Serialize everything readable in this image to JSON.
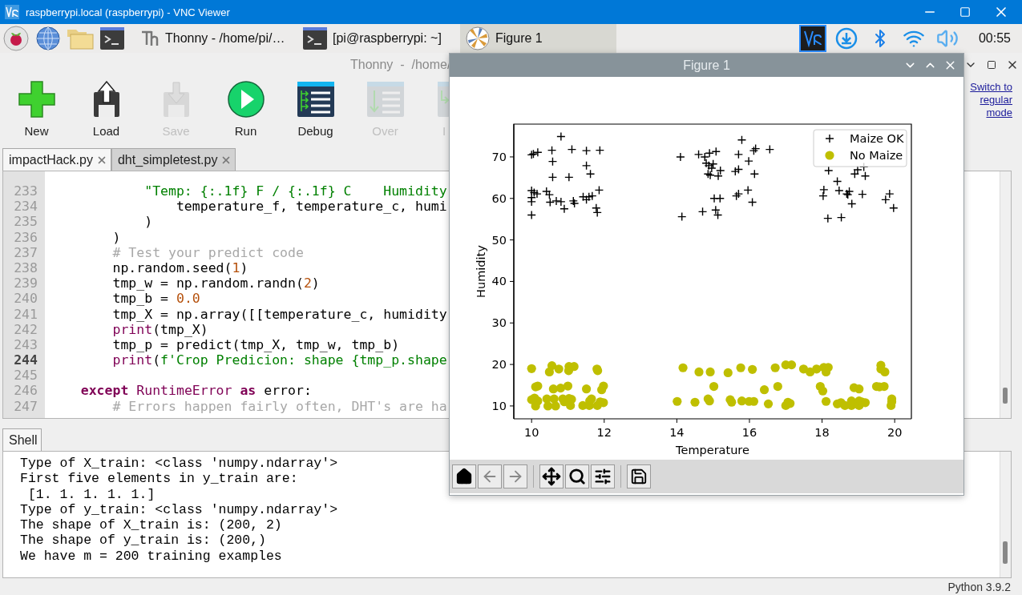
{
  "vnc_window": {
    "title": "raspberrypi.local (raspberrypi) - VNC Viewer"
  },
  "taskbar": {
    "launchers": [
      {
        "kind": "raspberry"
      },
      {
        "kind": "globe"
      },
      {
        "kind": "folder"
      },
      {
        "kind": "terminal"
      }
    ],
    "tasks": [
      {
        "kind": "thonny",
        "label": "Thonny  -  /home/pi/…",
        "selected": false
      },
      {
        "kind": "terminal",
        "label": "[pi@raspberrypi: ~]",
        "selected": false
      },
      {
        "kind": "figure",
        "label": "Figure 1",
        "selected": true
      }
    ],
    "tray": [
      {
        "kind": "vnc",
        "selected": true
      },
      {
        "kind": "download",
        "selected": false
      },
      {
        "kind": "bluetooth",
        "selected": false
      },
      {
        "kind": "wifi",
        "selected": false
      },
      {
        "kind": "volume",
        "selected": false
      }
    ],
    "clock": "00:55"
  },
  "thonny": {
    "title": "Thonny  -  /home/",
    "toolbar": [
      {
        "kind": "new",
        "label": "New",
        "disabled": false
      },
      {
        "kind": "load",
        "label": "Load",
        "disabled": false
      },
      {
        "kind": "save",
        "label": "Save",
        "disabled": true
      },
      {
        "kind": "run",
        "label": "Run",
        "disabled": false
      },
      {
        "kind": "debug",
        "label": "Debug",
        "disabled": false
      },
      {
        "kind": "over",
        "label": "Over",
        "disabled": true
      },
      {
        "kind": "into",
        "label": "I",
        "disabled": true
      }
    ],
    "mode_link": "Switch to regular mode",
    "tabs": [
      {
        "label": "impactHack.py",
        "selected": true
      },
      {
        "label": "dht_simpletest.py",
        "selected": false
      }
    ],
    "editor": {
      "lines": [
        {
          "number": "233",
          "current": false,
          "tokens": [
            {
              "text": "            \"Temp: {:.1f} F / {:.1f} C    Humidity",
              "kind": "string"
            }
          ]
        },
        {
          "number": "234",
          "current": false,
          "tokens": [
            {
              "text": "                temperature_f, temperature_c, humi",
              "kind": "plain"
            }
          ]
        },
        {
          "number": "235",
          "current": false,
          "tokens": [
            {
              "text": "            )",
              "kind": "plain"
            }
          ]
        },
        {
          "number": "236",
          "current": false,
          "tokens": [
            {
              "text": "        )",
              "kind": "plain"
            }
          ]
        },
        {
          "number": "237",
          "current": false,
          "tokens": [
            {
              "text": "        # Test your predict code",
              "kind": "comment"
            }
          ]
        },
        {
          "number": "238",
          "current": false,
          "tokens": [
            {
              "text": "        np.random.seed(",
              "kind": "plain"
            },
            {
              "text": "1",
              "kind": "number"
            },
            {
              "text": ")",
              "kind": "plain"
            }
          ]
        },
        {
          "number": "239",
          "current": false,
          "tokens": [
            {
              "text": "        tmp_w = np.random.randn(",
              "kind": "plain"
            },
            {
              "text": "2",
              "kind": "number"
            },
            {
              "text": ")",
              "kind": "plain"
            }
          ]
        },
        {
          "number": "240",
          "current": false,
          "tokens": [
            {
              "text": "        tmp_b = ",
              "kind": "plain"
            },
            {
              "text": "0.0",
              "kind": "number"
            }
          ]
        },
        {
          "number": "241",
          "current": false,
          "tokens": [
            {
              "text": "        tmp_X = np.array([[temperature_c, humidity",
              "kind": "plain"
            }
          ]
        },
        {
          "number": "242",
          "current": false,
          "tokens": [
            {
              "text": "        print",
              "kind": "builtin"
            },
            {
              "text": "(tmp_X)",
              "kind": "plain"
            }
          ]
        },
        {
          "number": "243",
          "current": false,
          "tokens": [
            {
              "text": "        tmp_p = predict(tmp_X, tmp_w, tmp_b)",
              "kind": "plain"
            }
          ]
        },
        {
          "number": "244",
          "current": true,
          "tokens": [
            {
              "text": "        print",
              "kind": "builtin"
            },
            {
              "text": "(",
              "kind": "plain"
            },
            {
              "text": "f'Crop Predicion: shape {tmp_p.shape",
              "kind": "string"
            }
          ]
        },
        {
          "number": "245",
          "current": false
        },
        {
          "number": "246",
          "current": false,
          "tokens": [
            {
              "text": "    except",
              "kind": "keyword"
            },
            {
              "text": " RuntimeError",
              "kind": "builtin"
            },
            {
              "text": " as",
              "kind": "keyword"
            },
            {
              "text": " error:",
              "kind": "plain"
            }
          ]
        },
        {
          "number": "247",
          "current": false,
          "tokens": [
            {
              "text": "        # Errors happen fairly often, DHT's are ha",
              "kind": "comment"
            }
          ]
        }
      ]
    },
    "shell": {
      "tab": "Shell",
      "lines": [
        "Type of X_train: <class 'numpy.ndarray'>",
        "First five elements in y_train are:",
        " [1. 1. 1. 1. 1.]",
        "Type of y_train: <class 'numpy.ndarray'>",
        "The shape of X_train is: (200, 2)",
        "The shape of y_train is: (200,)",
        "We have m = 200 training examples"
      ]
    },
    "status": "Python 3.9.2"
  },
  "figure": {
    "title": "Figure 1",
    "chart_data": {
      "type": "scatter",
      "legend": "upper right",
      "xlabel": "Temperature",
      "ylabel": "Humidity",
      "xlim": [
        9.51,
        20.46
      ],
      "ylim": [
        6.9,
        77.9
      ],
      "xticks": [
        10,
        12,
        14,
        16,
        18,
        20
      ],
      "yticks": [
        10,
        20,
        30,
        40,
        50,
        60,
        70
      ],
      "series": [
        {
          "name": "Maize OK",
          "color": "#000000",
          "marker": "plus",
          "x": [
            10.0,
            10.05,
            10.17,
            10.56,
            10.81,
            11.11,
            11.51,
            11.88,
            10.58,
            11.51,
            11.62,
            10.58,
            11.03,
            10.0,
            10.07,
            10.15,
            10.0,
            10.0,
            10.41,
            10.49,
            10.51,
            10.68,
            10.81,
            10.9,
            11.15,
            11.18,
            11.42,
            11.51,
            11.58,
            11.67,
            11.86,
            11.78,
            11.81,
            10.0,
            14.1,
            14.6,
            14.77,
            14.9,
            15.08,
            15.79,
            15.7,
            16.12,
            16.17,
            16.56,
            15.98,
            14.81,
            14.88,
            15.0,
            14.96,
            14.86,
            14.92,
            15.14,
            15.2,
            15.61,
            15.7,
            16.14,
            15.96,
            15.03,
            15.19,
            15.64,
            15.7,
            16.08,
            15.07,
            15.13,
            14.71,
            14.14,
            18.18,
            18.42,
            18.05,
            18.03,
            18.47,
            18.68,
            18.75,
            18.71,
            18.82,
            18.9,
            19.11,
            19.19,
            18.98,
            19.15,
            18.16,
            18.53,
            19.75,
            19.86,
            19.97
          ],
          "values": [
            70.5,
            70.7,
            71.1,
            71.6,
            74.9,
            71.8,
            71.5,
            71.6,
            68.9,
            67.9,
            65.9,
            65.1,
            65.1,
            61.9,
            61.4,
            61.1,
            60.2,
            59.2,
            61.7,
            60.9,
            59.1,
            59.4,
            59.2,
            57.5,
            59.4,
            58.8,
            60.4,
            59.7,
            60.4,
            60.6,
            62.0,
            57.7,
            56.6,
            56.0,
            70.0,
            70.6,
            70.0,
            70.9,
            71.3,
            74.1,
            70.6,
            71.5,
            72.0,
            71.8,
            69.0,
            68.5,
            67.9,
            68.3,
            67.3,
            65.9,
            65.6,
            65.4,
            66.7,
            66.5,
            67.0,
            65.9,
            62.0,
            60.0,
            60.0,
            60.6,
            61.1,
            59.1,
            57.2,
            56.0,
            56.8,
            55.6,
            66.7,
            64.1,
            62.1,
            60.6,
            61.9,
            61.1,
            61.7,
            60.9,
            58.7,
            65.9,
            61.0,
            65.4,
            66.9,
            67.6,
            55.2,
            55.4,
            59.7,
            61.1,
            57.7
          ]
        },
        {
          "name": "No Maize",
          "color": "#bfbf00",
          "marker": "circle",
          "x": [
            10.0,
            10.56,
            10.49,
            10.75,
            11.03,
            11.02,
            11.17,
            11.8,
            11.82,
            10.11,
            10.17,
            10.6,
            10.8,
            11.0,
            11.51,
            11.98,
            11.93,
            10.0,
            10.08,
            10.17,
            10.11,
            10.42,
            10.62,
            10.45,
            10.66,
            10.86,
            10.9,
            11.03,
            11.1,
            11.07,
            11.41,
            11.59,
            11.65,
            11.6,
            11.81,
            11.89,
            11.98,
            14.17,
            14.61,
            14.92,
            15.41,
            15.76,
            16.08,
            15.02,
            16.41,
            16.78,
            16.71,
            17.0,
            17.16,
            17.49,
            17.67,
            17.85,
            18.05,
            18.17,
            18.11,
            17.95,
            18.02,
            14.01,
            14.5,
            14.86,
            14.9,
            15.47,
            15.51,
            15.79,
            15.99,
            16.12,
            16.52,
            17.0,
            17.06,
            17.12,
            18.11,
            18.42,
            18.52,
            18.63,
            18.81,
            18.81,
            18.88,
            19.02,
            19.02,
            19.02,
            19.09,
            19.19,
            19.5,
            19.58,
            19.71,
            19.62,
            19.62,
            19.73,
            19.92,
            19.92,
            19.9
          ],
          "values": [
            19.0,
            19.7,
            18.2,
            18.9,
            19.5,
            18.5,
            19.5,
            18.9,
            18.5,
            14.6,
            14.8,
            14.1,
            14.3,
            14.8,
            14.1,
            14.8,
            13.9,
            11.5,
            11.9,
            11.2,
            10.0,
            11.7,
            11.7,
            10.0,
            10.0,
            11.7,
            11.0,
            11.8,
            11.6,
            10.1,
            10.1,
            10.1,
            11.7,
            11.2,
            10.1,
            11.0,
            10.8,
            19.2,
            18.2,
            18.2,
            18.0,
            19.2,
            18.8,
            14.7,
            13.9,
            14.7,
            19.2,
            19.9,
            19.9,
            18.9,
            18.2,
            18.9,
            19.3,
            19.3,
            18.2,
            14.7,
            13.6,
            11.1,
            10.9,
            11.7,
            11.2,
            11.5,
            10.9,
            11.2,
            11.1,
            11.1,
            10.5,
            10.1,
            10.9,
            10.6,
            11.1,
            10.5,
            10.8,
            10.1,
            11.2,
            10.1,
            14.4,
            14.1,
            11.2,
            10.1,
            11.0,
            10.8,
            14.7,
            14.6,
            14.7,
            19.8,
            18.9,
            18.2,
            11.7,
            11.0,
            10.1
          ]
        }
      ]
    },
    "toolbar": [
      {
        "kind": "home"
      },
      {
        "kind": "back"
      },
      {
        "kind": "forward"
      },
      {
        "kind": "pan"
      },
      {
        "kind": "zoom"
      },
      {
        "kind": "configure"
      },
      {
        "kind": "save"
      }
    ]
  }
}
